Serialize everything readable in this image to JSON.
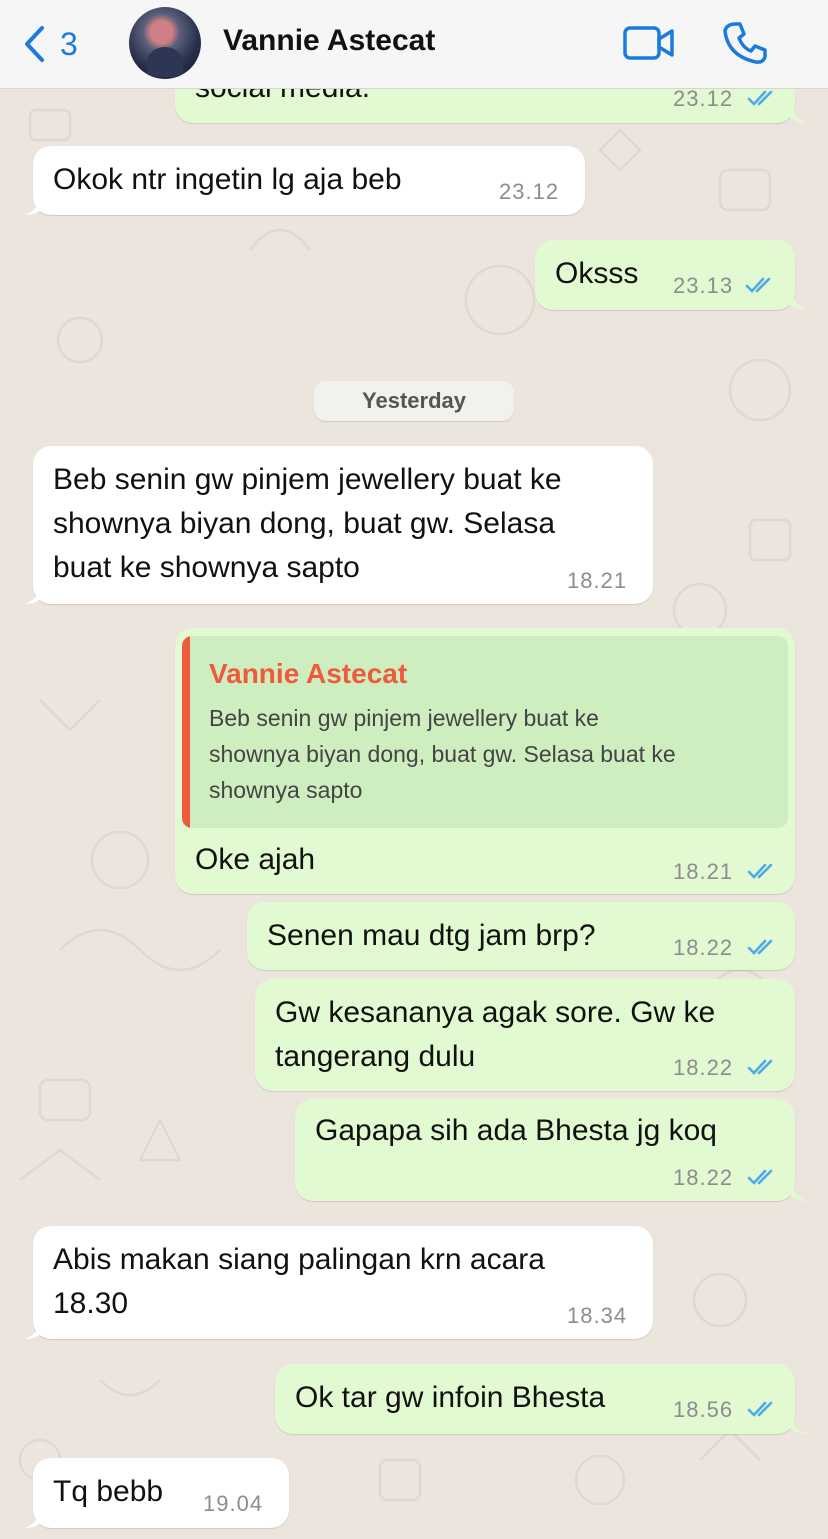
{
  "header": {
    "back_count": "3",
    "contact_name": "Vannie Astecat",
    "icons": [
      "chevron-left-icon",
      "video-camera-icon",
      "phone-icon"
    ],
    "accent_color": "#1a7ae0"
  },
  "date_separator": "Yesterday",
  "messages": [
    {
      "direction": "outgoing",
      "text": "social media.",
      "time": "23.12",
      "read": true
    },
    {
      "direction": "incoming",
      "text": "Okok ntr ingetin lg aja beb",
      "time": "23.12"
    },
    {
      "direction": "outgoing",
      "text": "Oksss",
      "time": "23.13",
      "read": true
    },
    {
      "direction": "incoming",
      "text": "Beb senin gw pinjem jewellery buat ke\nshownya biyan dong, buat gw. Selasa\nbuat ke shownya sapto",
      "time": "18.21"
    },
    {
      "direction": "outgoing",
      "reply_to": {
        "author": "Vannie Astecat",
        "text": "Beb senin gw pinjem jewellery buat ke\nshownya biyan dong, buat gw. Selasa buat ke\nshownya sapto"
      },
      "text": "Oke ajah",
      "time": "18.21",
      "read": true
    },
    {
      "direction": "outgoing",
      "text": "Senen mau dtg jam brp?",
      "time": "18.22",
      "read": true
    },
    {
      "direction": "outgoing",
      "text": "Gw kesananya agak sore. Gw ke\ntangerang dulu",
      "time": "18.22",
      "read": true
    },
    {
      "direction": "outgoing",
      "text": "Gapapa sih ada Bhesta jg koq",
      "time": "18.22",
      "read": true
    },
    {
      "direction": "incoming",
      "text": "Abis makan siang palingan krn acara\n18.30",
      "time": "18.34"
    },
    {
      "direction": "outgoing",
      "text": "Ok tar gw infoin Bhesta",
      "time": "18.56",
      "read": true
    },
    {
      "direction": "incoming",
      "text": "Tq bebb",
      "time": "19.04"
    }
  ],
  "colors": {
    "outgoing_bubble": "#e2fad1",
    "incoming_bubble": "#ffffff",
    "read_ticks": "#4fa8e8",
    "reply_author": "#f05a3c"
  }
}
